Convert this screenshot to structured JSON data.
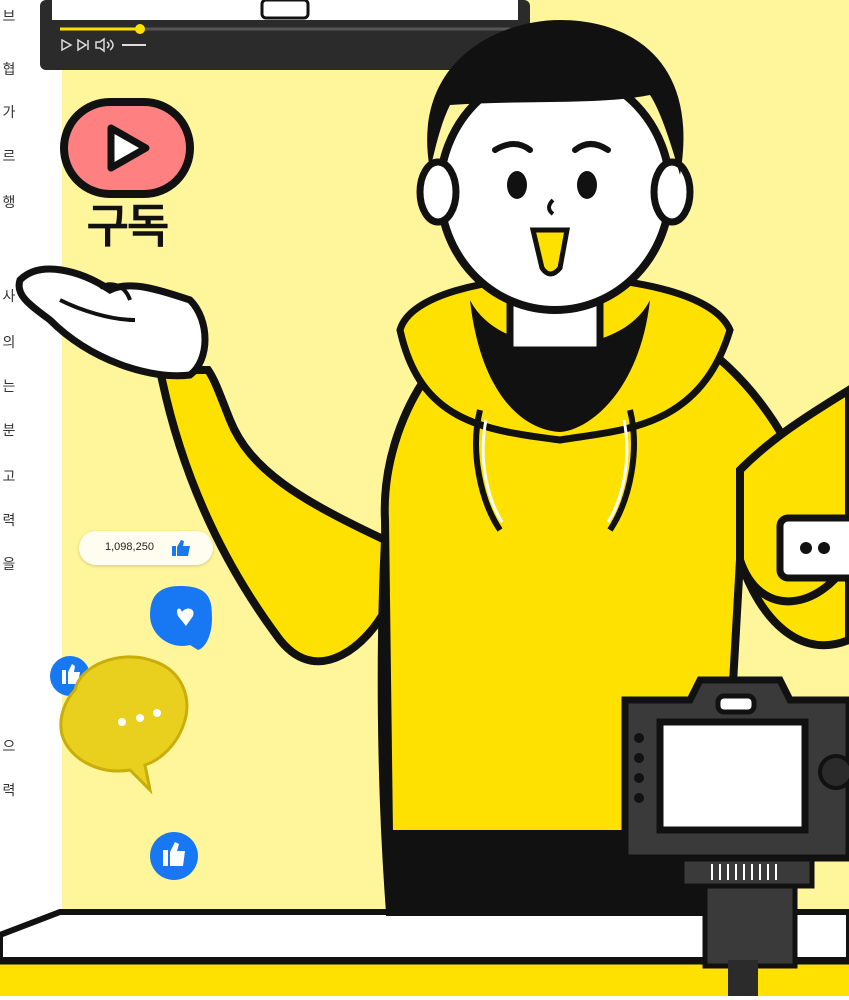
{
  "subscribe": {
    "label": "구독"
  },
  "likes": {
    "count": "1,098,250"
  },
  "side_text": [
    "브",
    "협",
    "가",
    "르",
    "행",
    "사",
    "의",
    "는",
    "분",
    "고",
    "력",
    "을",
    "으",
    "력"
  ],
  "colors": {
    "accent_yellow": "#ffe100",
    "background_yellow": "#fff59b",
    "play_red": "#ff8080",
    "like_blue": "#1877f2"
  },
  "icons": [
    "play-icon",
    "thumbs-up-icon",
    "heart-icon",
    "chat-bubble-icon",
    "camera-icon",
    "speaker-icon",
    "skip-icon"
  ]
}
